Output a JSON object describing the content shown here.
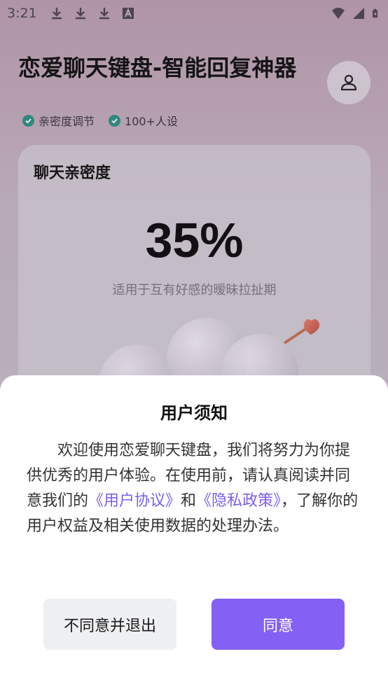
{
  "status_bar": {
    "time": "3:21",
    "left_icons": [
      "download-icon",
      "download-icon",
      "download-icon",
      "a-icon"
    ],
    "right_icons": [
      "wifi-icon",
      "signal-icon",
      "battery-icon"
    ]
  },
  "header": {
    "title": "恋爱聊天键盘-智能回复神器",
    "features": [
      "亲密度调节",
      "100+人设"
    ]
  },
  "card": {
    "label": "聊天亲密度",
    "percent": "35%",
    "description": "适用于互有好感的暧昧拉扯期"
  },
  "dialog": {
    "title": "用户须知",
    "body_prefix": "欢迎使用恋爱聊天键盘，我们将努力为你提供优秀的用户体验。在使用前，请认真阅读并同意我们的",
    "user_agreement": "《用户协议》",
    "and": "和",
    "privacy_policy": "《隐私政策》",
    "body_suffix": "，了解你的用户权益及相关使用数据的处理办法。",
    "decline_label": "不同意并退出",
    "agree_label": "同意"
  },
  "colors": {
    "accent": "#8560f5",
    "link": "#7b5ff0",
    "check": "#2e8f82"
  }
}
